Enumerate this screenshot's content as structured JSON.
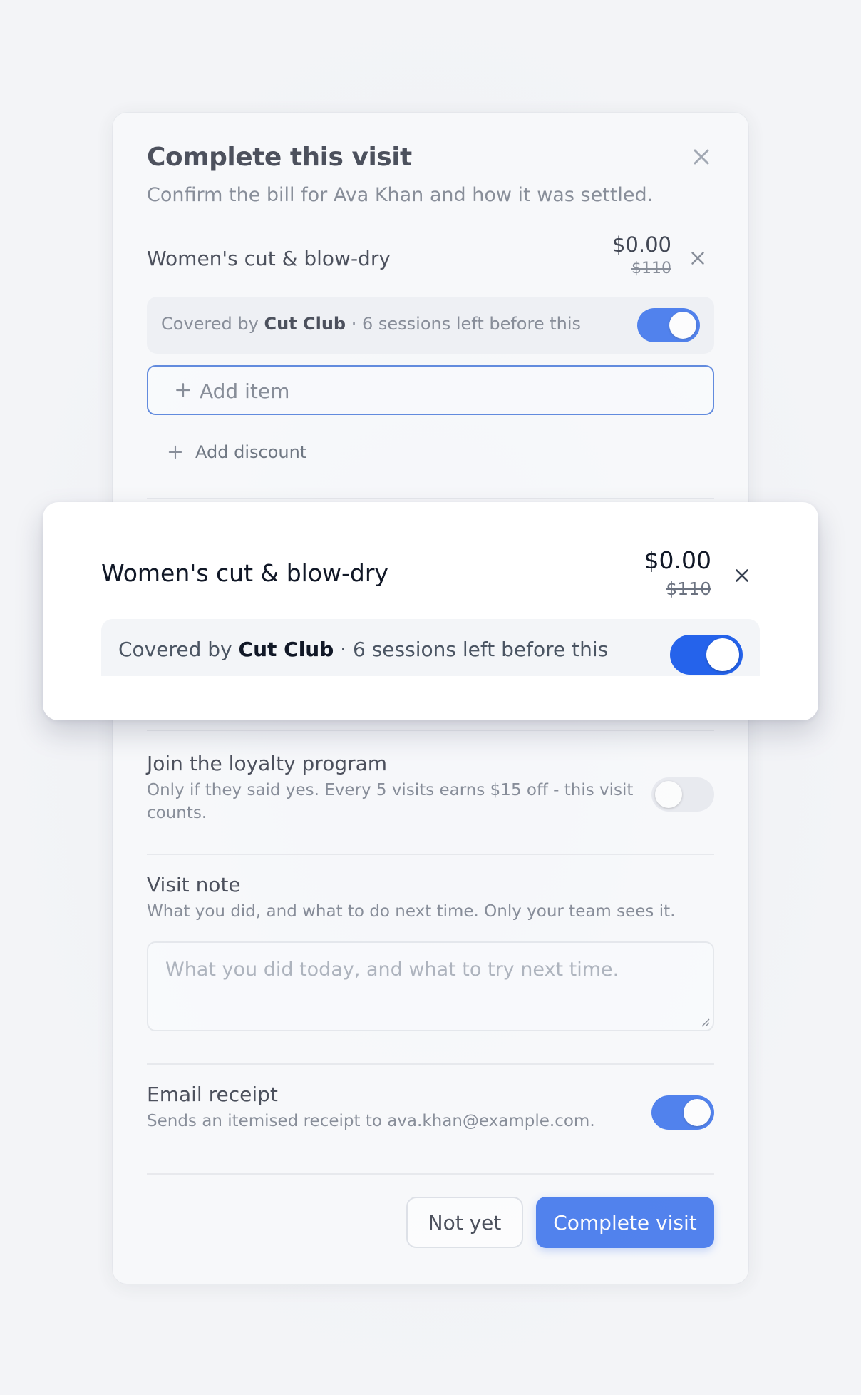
{
  "modal": {
    "title": "Complete this visit",
    "subtitle": "Confirm the bill for Ava Khan and how it was settled.",
    "line_item": {
      "name": "Women's cut & blow-dry",
      "price": "$0.00",
      "original_price": "$110"
    },
    "coverage": {
      "prefix": "Covered by ",
      "membership": "Cut Club",
      "suffix": " · 6 sessions left before this",
      "enabled": true
    },
    "add_item_label": "Add item",
    "add_discount_label": "Add discount",
    "loyalty": {
      "title": "Join the loyalty program",
      "description": "Only if they said yes. Every 5 visits earns $15 off - this visit counts.",
      "enabled": false
    },
    "note": {
      "title": "Visit note",
      "description": "What you did, and what to do next time. Only your team sees it.",
      "placeholder": "What you did today, and what to try next time."
    },
    "email_receipt": {
      "title": "Email receipt",
      "description": "Sends an itemised receipt to ava.khan@example.com.",
      "enabled": true
    },
    "actions": {
      "secondary": "Not yet",
      "primary": "Complete visit"
    }
  },
  "colors": {
    "accent": "#2563eb",
    "toggle_off": "#e6e8ee"
  },
  "icons": {
    "close": "close-icon",
    "plus": "plus-icon"
  }
}
